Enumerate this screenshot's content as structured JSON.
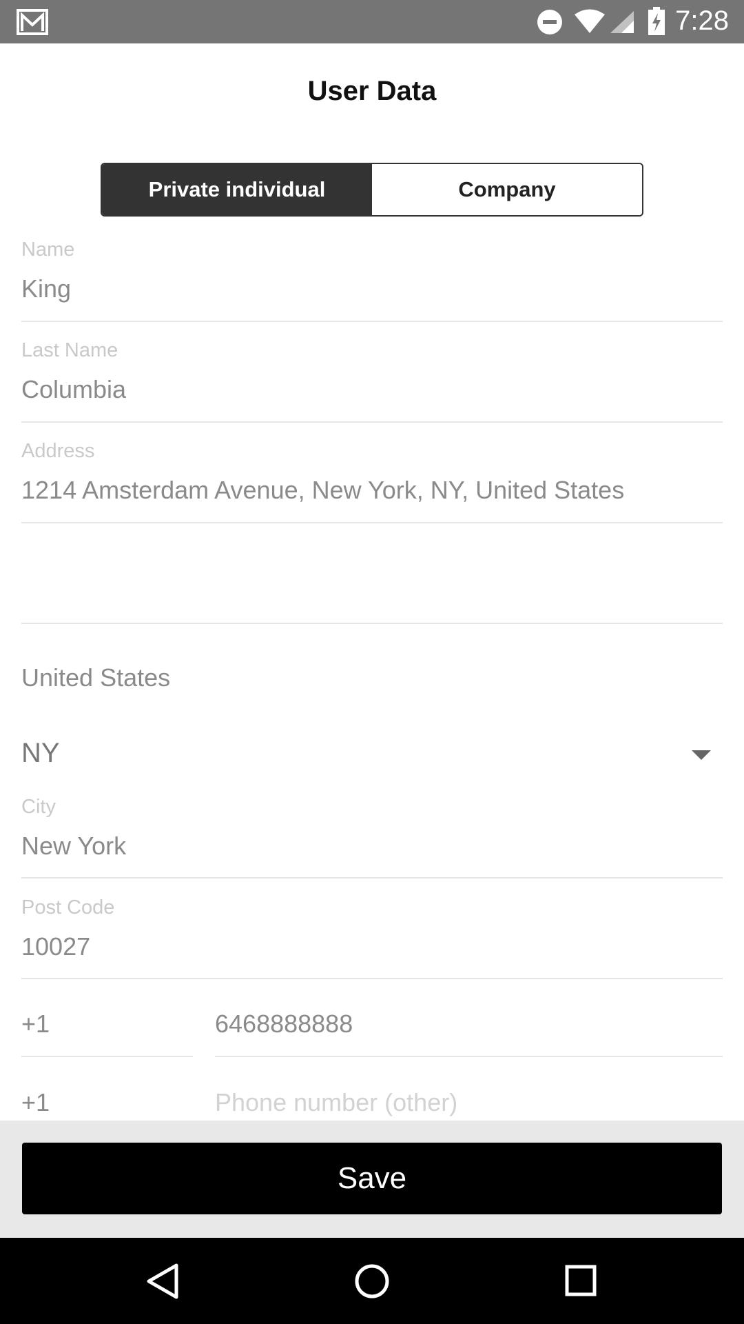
{
  "status_bar": {
    "time": "7:28",
    "icons": [
      "gmail-icon",
      "do-not-disturb-icon",
      "wifi-icon",
      "signal-icon",
      "battery-charging-icon"
    ]
  },
  "header": {
    "title": "User Data"
  },
  "segment": {
    "options": [
      {
        "label": "Private individual",
        "selected": true
      },
      {
        "label": "Company",
        "selected": false
      }
    ]
  },
  "form": {
    "name": {
      "label": "Name",
      "value": "King"
    },
    "last_name": {
      "label": "Last Name",
      "value": "Columbia"
    },
    "address": {
      "label": "Address",
      "value": "1214 Amsterdam Avenue, New York, NY, United States"
    },
    "address2": {
      "value": ""
    },
    "country": "United States",
    "state": "NY",
    "city": {
      "label": "City",
      "value": "New York"
    },
    "post_code": {
      "label": "Post Code",
      "value": "10027"
    },
    "phone": {
      "prefix": "+1",
      "number": "6468888888"
    },
    "phone_other": {
      "prefix": "+1",
      "placeholder": "Phone number (other)"
    }
  },
  "actions": {
    "save_label": "Save"
  },
  "nav_bar": {
    "icons": [
      "back-icon",
      "home-icon",
      "recents-icon"
    ]
  },
  "colors": {
    "status_bar": "#757575",
    "active_segment": "#333333",
    "save_button": "#000000",
    "nav_bar": "#000000"
  }
}
